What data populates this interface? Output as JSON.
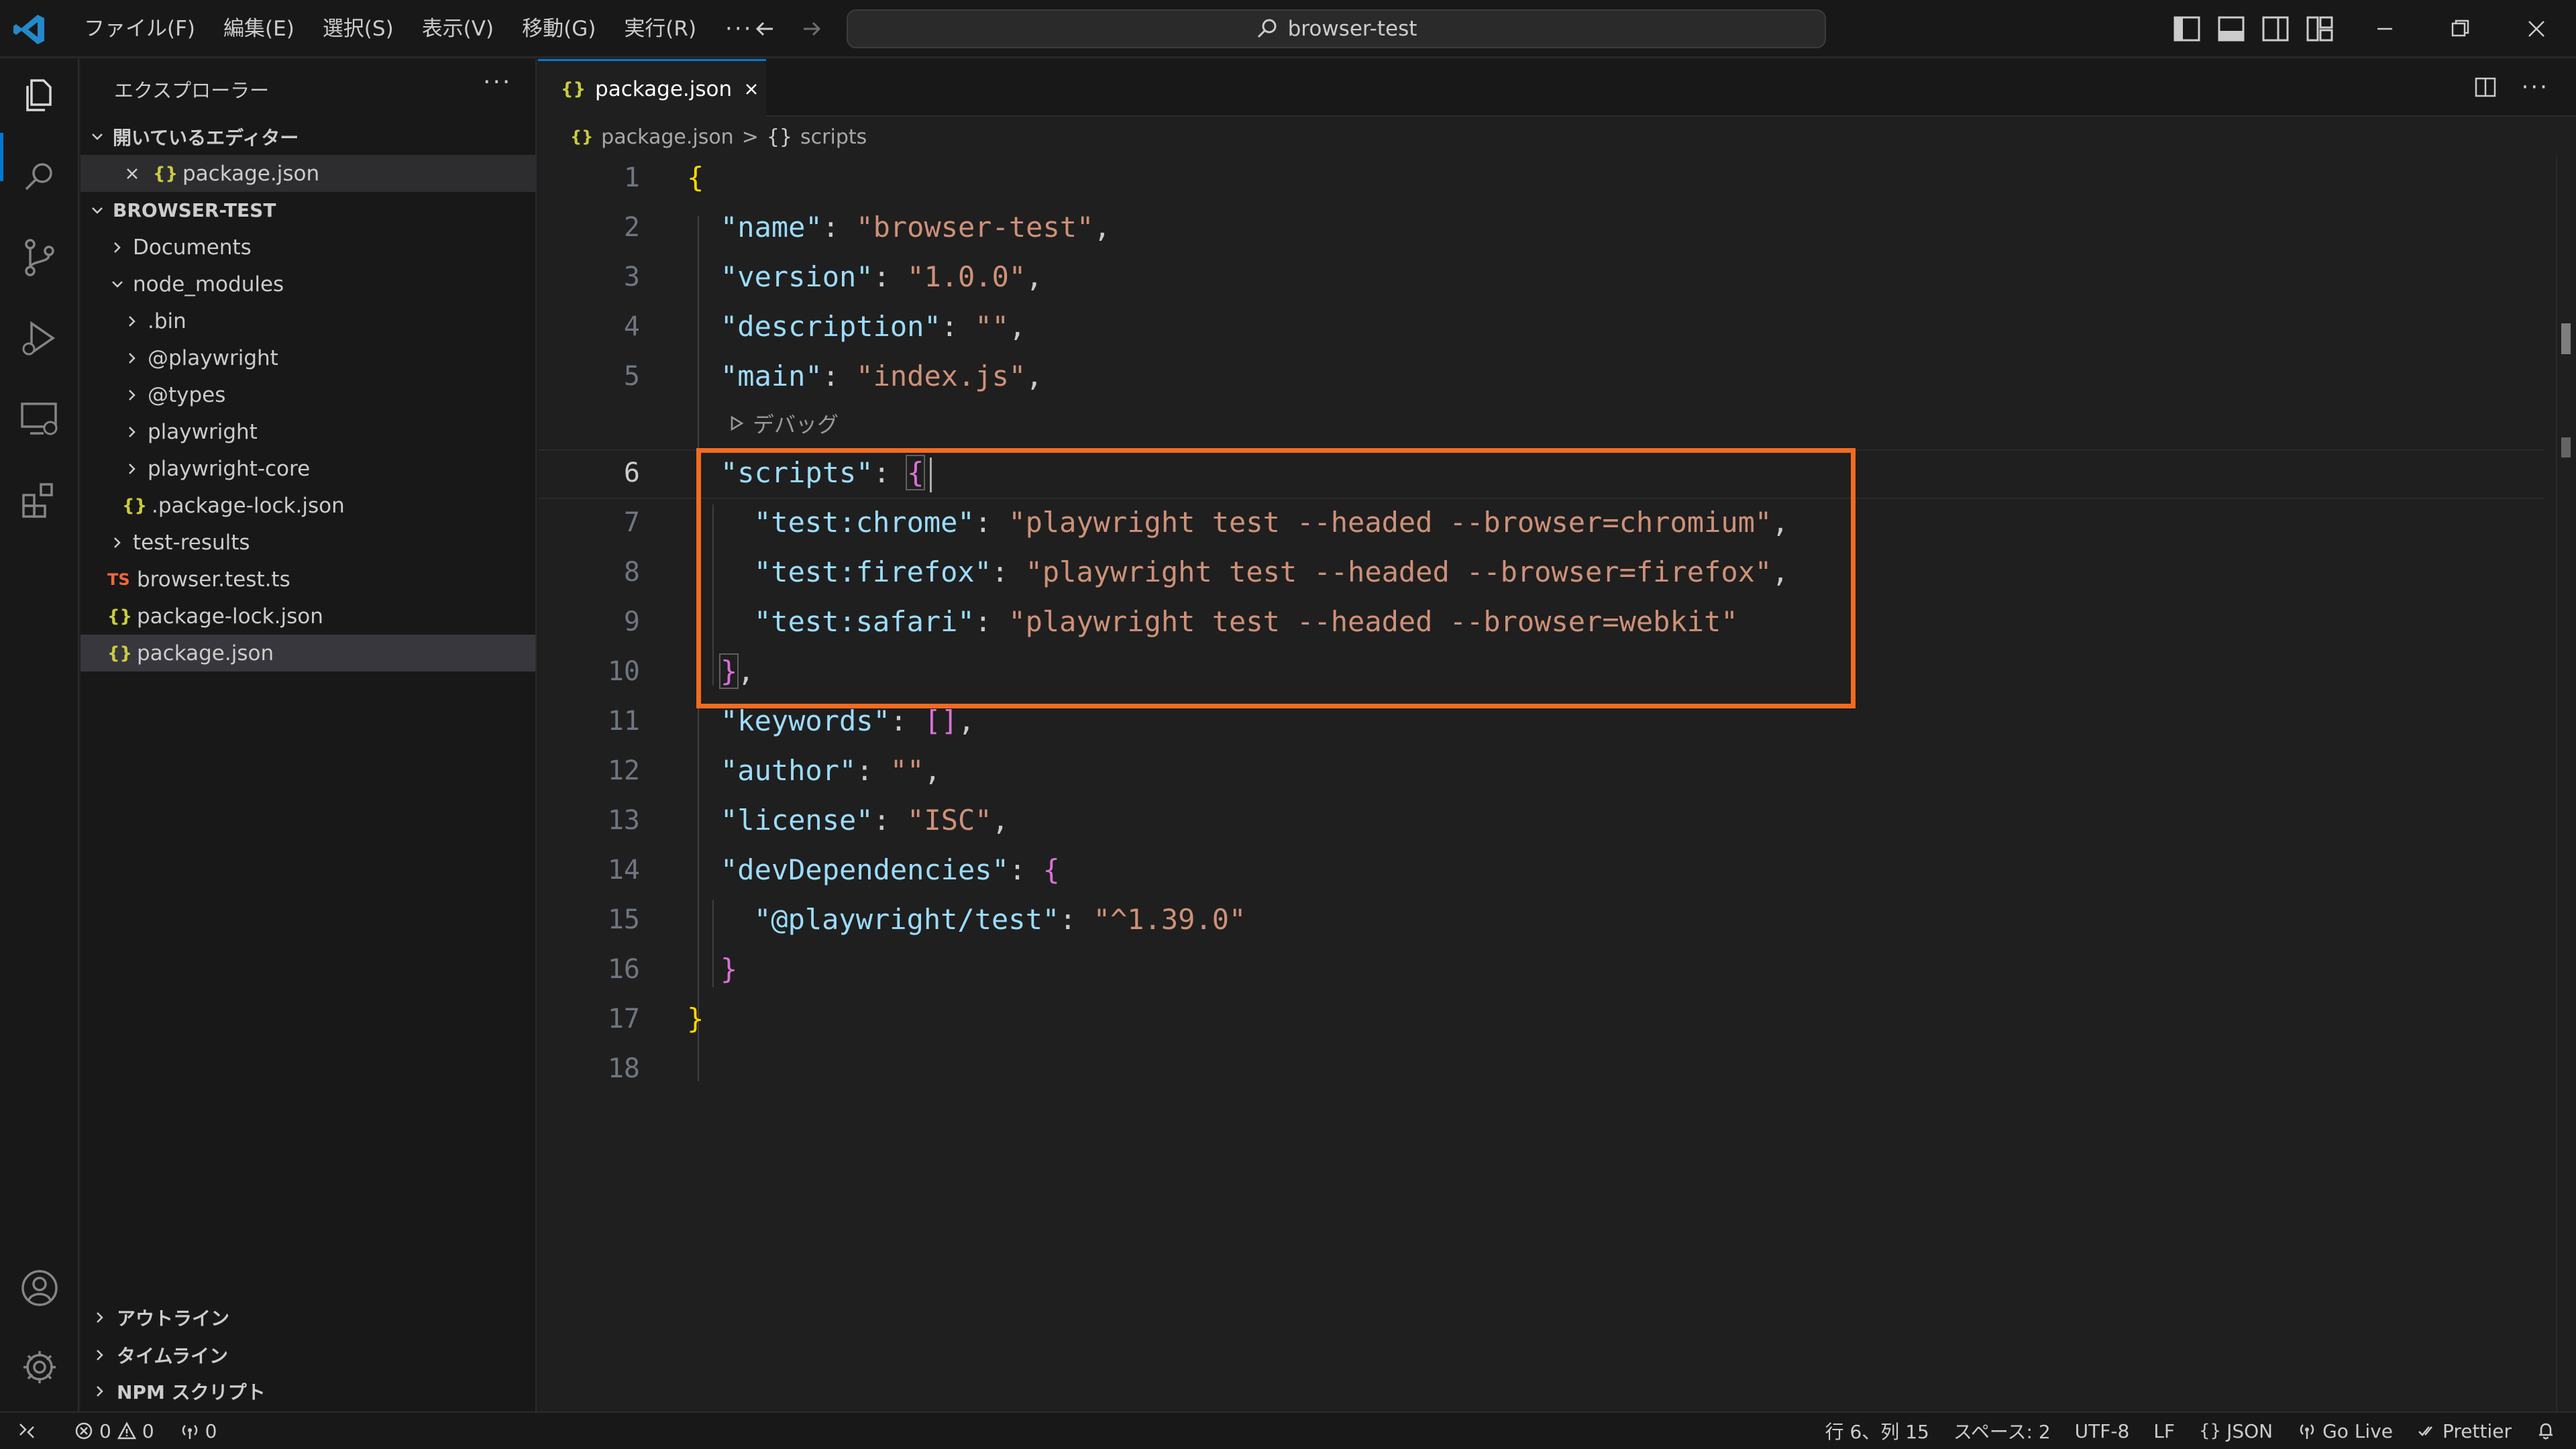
{
  "window": {
    "command_center": "browser-test"
  },
  "menu": [
    "ファイル(F)",
    "編集(E)",
    "選択(S)",
    "表示(V)",
    "移動(G)",
    "実行(R)"
  ],
  "menu_more": "···",
  "sidebar": {
    "title": "エクスプローラー",
    "more": "···",
    "open_editors_header": "開いているエディター",
    "open_editors": [
      {
        "name": "package.json",
        "icon": "json-icon"
      }
    ],
    "project_header": "BROWSER-TEST",
    "tree": [
      {
        "label": "Documents",
        "kind": "folder",
        "expanded": false
      },
      {
        "label": "node_modules",
        "kind": "folder",
        "expanded": true
      },
      {
        "label": ".bin",
        "kind": "folder",
        "expanded": false
      },
      {
        "label": "@playwright",
        "kind": "folder",
        "expanded": false
      },
      {
        "label": "@types",
        "kind": "folder",
        "expanded": false
      },
      {
        "label": "playwright",
        "kind": "folder",
        "expanded": false
      },
      {
        "label": "playwright-core",
        "kind": "folder",
        "expanded": false
      },
      {
        "label": ".package-lock.json",
        "kind": "json"
      },
      {
        "label": "test-results",
        "kind": "folder",
        "expanded": false
      },
      {
        "label": "browser.test.ts",
        "kind": "ts"
      },
      {
        "label": "package-lock.json",
        "kind": "json"
      },
      {
        "label": "package.json",
        "kind": "json",
        "selected": true
      }
    ],
    "panels": [
      "アウトライン",
      "タイムライン",
      "NPM スクリプト"
    ],
    "json_glyph": "{}",
    "ts_glyph": "TS"
  },
  "editor": {
    "tab_label": "package.json",
    "breadcrumb": [
      "package.json",
      "scripts"
    ],
    "breadcrumb_sep": ">",
    "breadcrumb_glyph": "{}",
    "codelens": "デバッグ",
    "current_line": 6,
    "line_numbers": [
      "1",
      "2",
      "3",
      "4",
      "5",
      "6",
      "7",
      "8",
      "9",
      "10",
      "11",
      "12",
      "13",
      "14",
      "15",
      "16",
      "17",
      "18"
    ],
    "lines": {
      "l1_open": "{",
      "name_key": "\"name\"",
      "name_val": "\"browser-test\"",
      "version_key": "\"version\"",
      "version_val": "\"1.0.0\"",
      "desc_key": "\"description\"",
      "desc_val": "\"\"",
      "main_key": "\"main\"",
      "main_val": "\"index.js\"",
      "scripts_key": "\"scripts\"",
      "chrome_key": "\"test:chrome\"",
      "chrome_val": "\"playwright test --headed --browser=chromium\"",
      "firefox_key": "\"test:firefox\"",
      "firefox_val": "\"playwright test --headed --browser=firefox\"",
      "safari_key": "\"test:safari\"",
      "safari_val": "\"playwright test --headed --browser=webkit\"",
      "keywords_key": "\"keywords\"",
      "author_key": "\"author\"",
      "author_val": "\"\"",
      "license_key": "\"license\"",
      "license_val": "\"ISC\"",
      "devdeps_key": "\"devDependencies\"",
      "pw_key": "\"@playwright/test\"",
      "pw_val": "\"^1.39.0\""
    }
  },
  "statusbar": {
    "errors": "0",
    "warnings": "0",
    "ports": "0",
    "position": "行 6、列 15",
    "spaces": "スペース: 2",
    "encoding": "UTF-8",
    "eol": "LF",
    "language": "JSON",
    "golive": "Go Live",
    "prettier": "Prettier"
  },
  "colors": {
    "accent": "#0078d4",
    "highlight_box": "#f46b20",
    "json_key": "#9cdcfe",
    "json_string": "#ce9178",
    "bracket_gold": "#ffd700",
    "bracket_purple": "#da70d6",
    "bracket_blue": "#179fff"
  }
}
